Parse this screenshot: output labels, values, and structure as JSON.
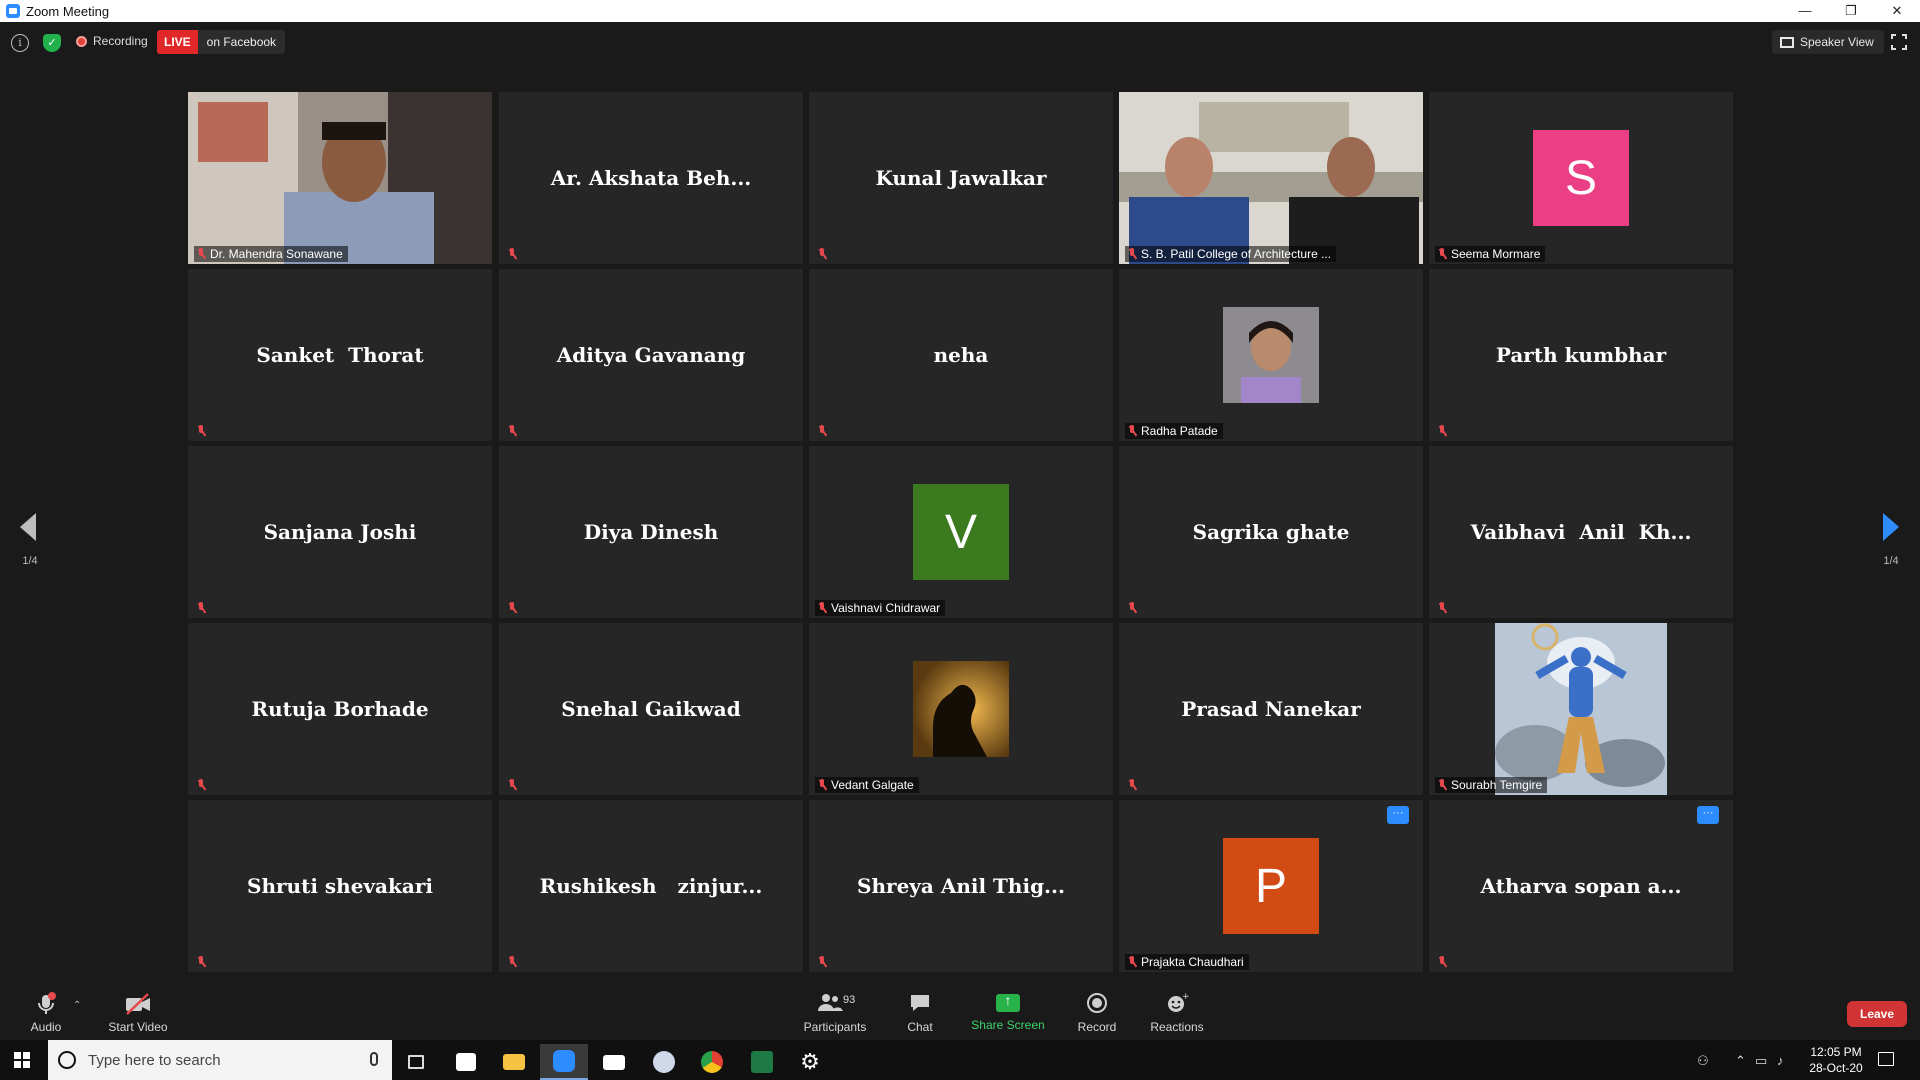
{
  "window": {
    "title": "Zoom Meeting",
    "controls": [
      "—",
      "❐",
      "✕"
    ]
  },
  "topbar": {
    "recording_label": "Recording",
    "live_label": "LIVE",
    "live_platform": "on Facebook",
    "view_label": "Speaker View"
  },
  "pagination": {
    "left": "1/4",
    "right": "1/4"
  },
  "tiles": [
    {
      "name": "Dr. Mahendra Sonawane",
      "display": "",
      "kind": "video-person",
      "active": false
    },
    {
      "name": "",
      "display": "Ar. Akshata Beh...",
      "kind": "name",
      "active": false
    },
    {
      "name": "",
      "display": "Kunal Jawalkar",
      "kind": "name",
      "active": false
    },
    {
      "name": "S. B. Patil College of Architecture ...",
      "display": "",
      "kind": "video-room",
      "active": true
    },
    {
      "name": "Seema Mormare",
      "display": "",
      "kind": "avatar",
      "letter": "S",
      "color": "#ea3f85",
      "active": false
    },
    {
      "name": "",
      "display": "Sanket  Thorat",
      "kind": "name",
      "active": false
    },
    {
      "name": "",
      "display": "Aditya Gavanang",
      "kind": "name",
      "active": false
    },
    {
      "name": "",
      "display": "neha",
      "kind": "name",
      "active": false
    },
    {
      "name": "Radha Patade",
      "display": "",
      "kind": "photo",
      "photo": "girl",
      "active": false
    },
    {
      "name": "",
      "display": "Parth kumbhar",
      "kind": "name",
      "active": false
    },
    {
      "name": "",
      "display": "Sanjana Joshi",
      "kind": "name",
      "active": false
    },
    {
      "name": "",
      "display": "Diya Dinesh",
      "kind": "name",
      "active": false
    },
    {
      "name": "Vaishnavi Chidrawar",
      "display": "",
      "kind": "avatar",
      "letter": "V",
      "color": "#3b7a1e",
      "active": false
    },
    {
      "name": "",
      "display": "Sagrika ghate",
      "kind": "name",
      "active": false
    },
    {
      "name": "",
      "display": "Vaibhavi  Anil  Kh...",
      "kind": "name",
      "active": false
    },
    {
      "name": "",
      "display": "Rutuja Borhade",
      "kind": "name",
      "active": false
    },
    {
      "name": "",
      "display": "Snehal Gaikwad",
      "kind": "name",
      "active": false
    },
    {
      "name": "Vedant Galgate",
      "display": "",
      "kind": "photo",
      "photo": "silhouette",
      "active": false
    },
    {
      "name": "",
      "display": "Prasad Nanekar",
      "kind": "name",
      "active": false
    },
    {
      "name": "Sourabh Temgire",
      "display": "",
      "kind": "deity",
      "active": false
    },
    {
      "name": "",
      "display": "Shruti shevakari",
      "kind": "name",
      "active": false
    },
    {
      "name": "",
      "display": "Rushikesh   zinjur...",
      "kind": "name",
      "active": false
    },
    {
      "name": "",
      "display": "Shreya Anil Thig...",
      "kind": "name",
      "active": false
    },
    {
      "name": "Prajakta Chaudhari",
      "display": "",
      "kind": "avatar",
      "letter": "P",
      "color": "#d24a14",
      "more": "···",
      "active": false
    },
    {
      "name": "",
      "display": "Atharva sopan a...",
      "kind": "name",
      "more": "···",
      "active": false
    }
  ],
  "toolbar": {
    "audio": "Audio",
    "start_video": "Start Video",
    "participants": "Participants",
    "participants_count": "93",
    "chat": "Chat",
    "share_screen": "Share Screen",
    "record": "Record",
    "reactions": "Reactions",
    "leave": "Leave"
  },
  "taskbar": {
    "search_placeholder": "Type here to search",
    "time": "12:05 PM",
    "date": "28-Oct-20"
  }
}
